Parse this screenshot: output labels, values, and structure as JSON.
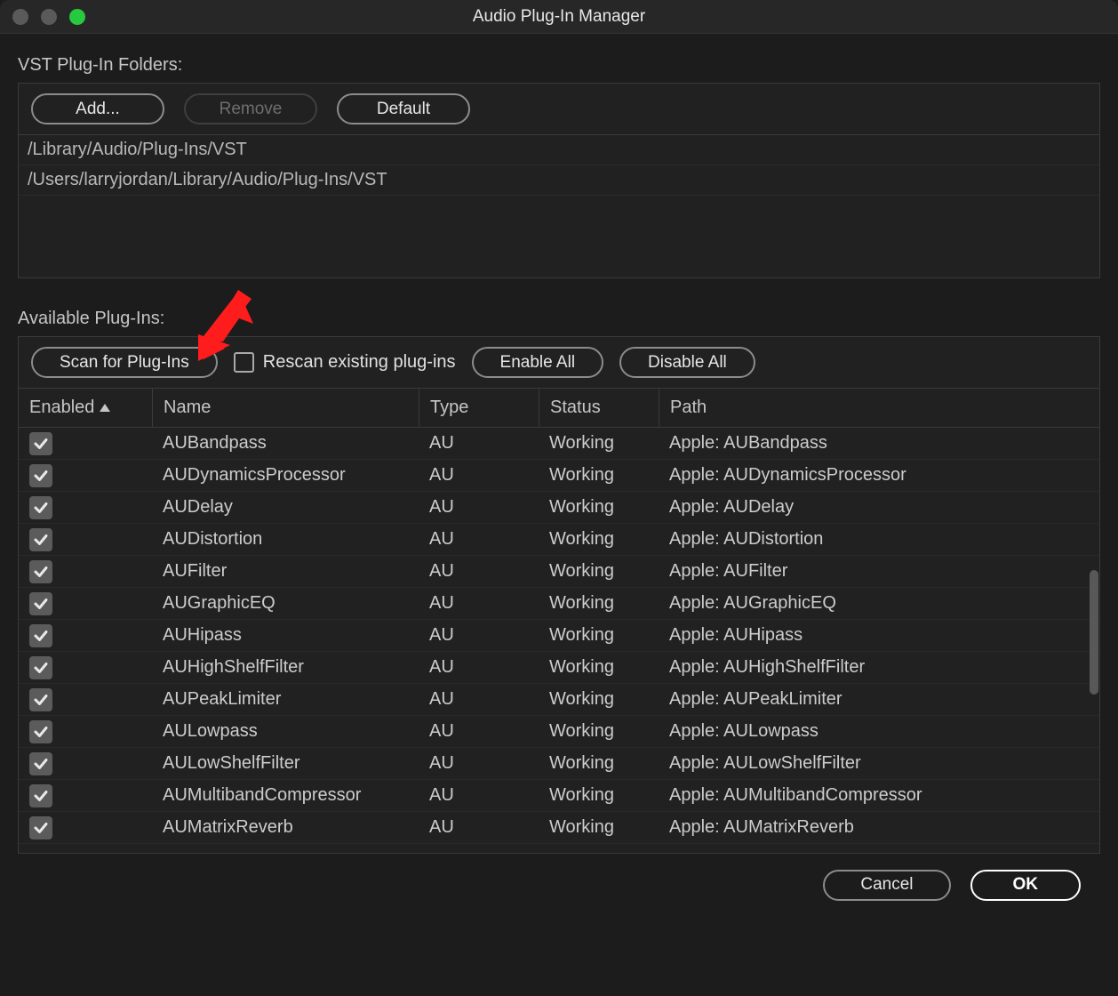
{
  "titlebar": {
    "title": "Audio Plug-In Manager"
  },
  "folders_section": {
    "label": "VST Plug-In Folders:",
    "buttons": {
      "add": "Add...",
      "remove": "Remove",
      "default": "Default"
    },
    "paths": [
      "/Library/Audio/Plug-Ins/VST",
      "/Users/larryjordan/Library/Audio/Plug-Ins/VST"
    ]
  },
  "plugins_section": {
    "label": "Available Plug-Ins:",
    "buttons": {
      "scan": "Scan for Plug-Ins",
      "rescan_label": "Rescan existing plug-ins",
      "enable_all": "Enable All",
      "disable_all": "Disable All"
    },
    "columns": {
      "enabled": "Enabled",
      "name": "Name",
      "type": "Type",
      "status": "Status",
      "path": "Path"
    },
    "rows": [
      {
        "enabled": true,
        "name": "AUBandpass",
        "type": "AU",
        "status": "Working",
        "path": "Apple: AUBandpass"
      },
      {
        "enabled": true,
        "name": "AUDynamicsProcessor",
        "type": "AU",
        "status": "Working",
        "path": "Apple: AUDynamicsProcessor"
      },
      {
        "enabled": true,
        "name": "AUDelay",
        "type": "AU",
        "status": "Working",
        "path": "Apple: AUDelay"
      },
      {
        "enabled": true,
        "name": "AUDistortion",
        "type": "AU",
        "status": "Working",
        "path": "Apple: AUDistortion"
      },
      {
        "enabled": true,
        "name": "AUFilter",
        "type": "AU",
        "status": "Working",
        "path": "Apple: AUFilter"
      },
      {
        "enabled": true,
        "name": "AUGraphicEQ",
        "type": "AU",
        "status": "Working",
        "path": "Apple: AUGraphicEQ"
      },
      {
        "enabled": true,
        "name": "AUHipass",
        "type": "AU",
        "status": "Working",
        "path": "Apple: AUHipass"
      },
      {
        "enabled": true,
        "name": "AUHighShelfFilter",
        "type": "AU",
        "status": "Working",
        "path": "Apple: AUHighShelfFilter"
      },
      {
        "enabled": true,
        "name": "AUPeakLimiter",
        "type": "AU",
        "status": "Working",
        "path": "Apple: AUPeakLimiter"
      },
      {
        "enabled": true,
        "name": "AULowpass",
        "type": "AU",
        "status": "Working",
        "path": "Apple: AULowpass"
      },
      {
        "enabled": true,
        "name": "AULowShelfFilter",
        "type": "AU",
        "status": "Working",
        "path": "Apple: AULowShelfFilter"
      },
      {
        "enabled": true,
        "name": "AUMultibandCompressor",
        "type": "AU",
        "status": "Working",
        "path": "Apple: AUMultibandCompressor"
      },
      {
        "enabled": true,
        "name": "AUMatrixReverb",
        "type": "AU",
        "status": "Working",
        "path": "Apple: AUMatrixReverb"
      }
    ]
  },
  "footer": {
    "cancel": "Cancel",
    "ok": "OK"
  }
}
